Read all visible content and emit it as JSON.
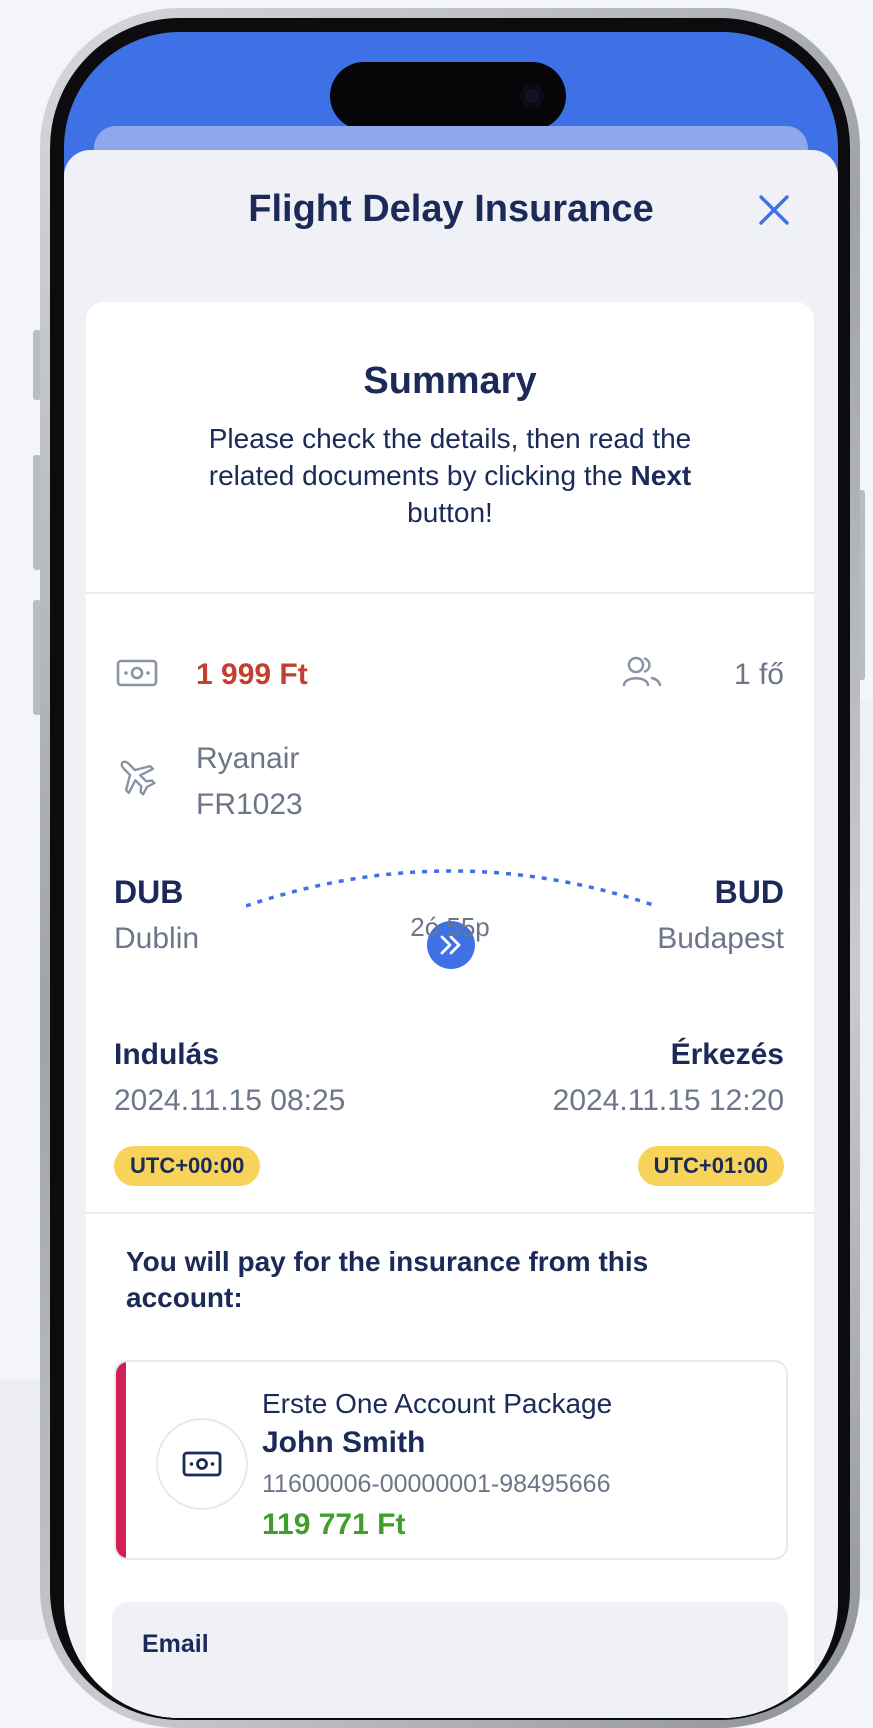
{
  "sheet": {
    "title": "Flight Delay Insurance",
    "close_icon": "close-icon"
  },
  "summary": {
    "title": "Summary",
    "text_before": "Please check the details, then read the related documents by clicking the",
    "text_bold": "Next",
    "text_after": "button!"
  },
  "flight": {
    "price": "1 999 Ft",
    "persons": "1 fő",
    "airline": "Ryanair",
    "flight_number": "FR1023",
    "origin_code": "DUB",
    "origin_city": "Dublin",
    "destination_code": "BUD",
    "destination_city": "Budapest",
    "duration": "2ó 55p",
    "departure_label": "Indulás",
    "departure_time": "2024.11.15 08:25",
    "departure_tz": "UTC+00:00",
    "arrival_label": "Érkezés",
    "arrival_time": "2024.11.15 12:20",
    "arrival_tz": "UTC+01:00"
  },
  "payment": {
    "title": "You will pay for the insurance from this account:",
    "account_name": "Erste One Account Package",
    "owner": "John Smith",
    "account_number": "11600006-00000001-98495666",
    "balance": "119 771 Ft"
  },
  "email": {
    "label": "Email"
  },
  "colors": {
    "primary_blue": "#3f71e6",
    "navy_text": "#1b2a58",
    "price_red": "#c2402f",
    "balance_green": "#3f9e2d",
    "utc_badge_yellow": "#f7d35a",
    "account_accent": "#d21f55"
  }
}
